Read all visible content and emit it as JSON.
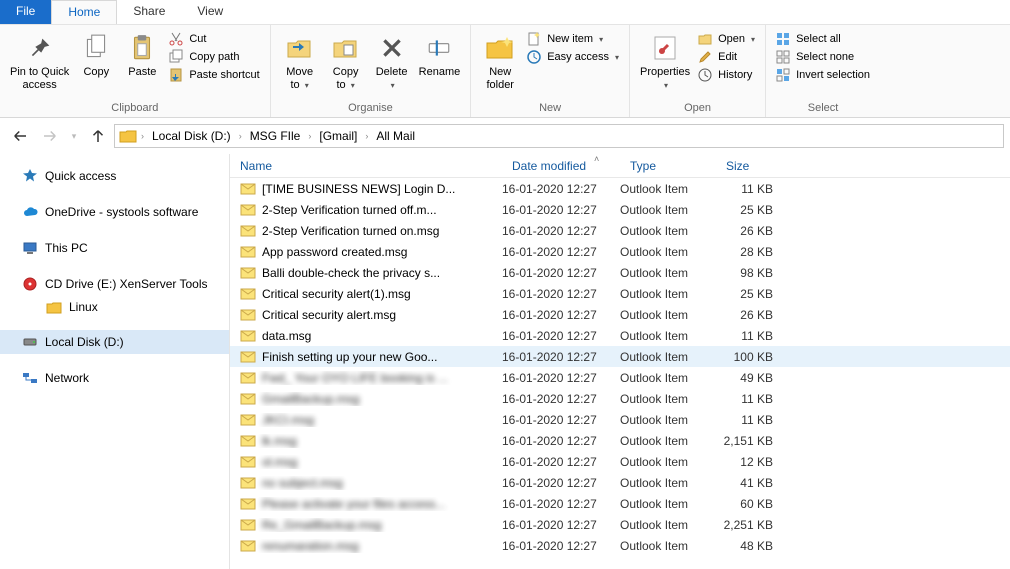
{
  "tabs": {
    "file": "File",
    "home": "Home",
    "share": "Share",
    "view": "View"
  },
  "ribbon": {
    "clipboard": {
      "label": "Clipboard",
      "pin": "Pin to Quick\naccess",
      "copy": "Copy",
      "paste": "Paste",
      "cut": "Cut",
      "copy_path": "Copy path",
      "paste_shortcut": "Paste shortcut"
    },
    "organise": {
      "label": "Organise",
      "move_to": "Move\nto",
      "copy_to": "Copy\nto",
      "delete": "Delete",
      "rename": "Rename"
    },
    "new": {
      "label": "New",
      "new_folder": "New\nfolder",
      "new_item": "New item",
      "easy_access": "Easy access"
    },
    "open": {
      "label": "Open",
      "properties": "Properties",
      "open": "Open",
      "edit": "Edit",
      "history": "History"
    },
    "select": {
      "label": "Select",
      "select_all": "Select all",
      "select_none": "Select none",
      "invert": "Invert selection"
    }
  },
  "breadcrumb": [
    "Local Disk (D:)",
    "MSG FIle",
    "[Gmail]",
    "All Mail"
  ],
  "nav": {
    "quick": "Quick access",
    "onedrive": "OneDrive - systools software",
    "thispc": "This PC",
    "cd": "CD Drive (E:) XenServer Tools",
    "linux": "Linux",
    "locald": "Local Disk (D:)",
    "network": "Network"
  },
  "columns": {
    "name": "Name",
    "date": "Date modified",
    "type": "Type",
    "size": "Size"
  },
  "common": {
    "type": "Outlook Item",
    "date": "16-01-2020 12:27"
  },
  "files": [
    {
      "name": "[TIME BUSINESS NEWS] Login D...",
      "size": "11 KB",
      "blur": false
    },
    {
      "name": "2-Step Verification turned off.m...",
      "size": "25 KB",
      "blur": false
    },
    {
      "name": "2-Step Verification turned on.msg",
      "size": "26 KB",
      "blur": false
    },
    {
      "name": "App password created.msg",
      "size": "28 KB",
      "blur": false
    },
    {
      "name": "Balli double-check the privacy s...",
      "size": "98 KB",
      "blur": false
    },
    {
      "name": "Critical security alert(1).msg",
      "size": "25 KB",
      "blur": false
    },
    {
      "name": "Critical security alert.msg",
      "size": "26 KB",
      "blur": false
    },
    {
      "name": "data.msg",
      "size": "11 KB",
      "blur": false
    },
    {
      "name": "Finish setting up your new Goo...",
      "size": "100 KB",
      "blur": false,
      "hover": true
    },
    {
      "name": "Fwd_ Your OYO LIFE booking is ...",
      "size": "49 KB",
      "blur": true
    },
    {
      "name": "GmailBackup.msg",
      "size": "11 KB",
      "blur": true
    },
    {
      "name": "JKCI.msg",
      "size": "11 KB",
      "blur": true
    },
    {
      "name": "lk.msg",
      "size": "2,151 KB",
      "blur": true
    },
    {
      "name": "ol.msg",
      "size": "12 KB",
      "blur": true
    },
    {
      "name": "no subject.msg",
      "size": "41 KB",
      "blur": true
    },
    {
      "name": "Please activate your files access...",
      "size": "60 KB",
      "blur": true
    },
    {
      "name": "Re_GmailBackup.msg",
      "size": "2,251 KB",
      "blur": true
    },
    {
      "name": "renumaration.msg",
      "size": "48 KB",
      "blur": true
    }
  ]
}
